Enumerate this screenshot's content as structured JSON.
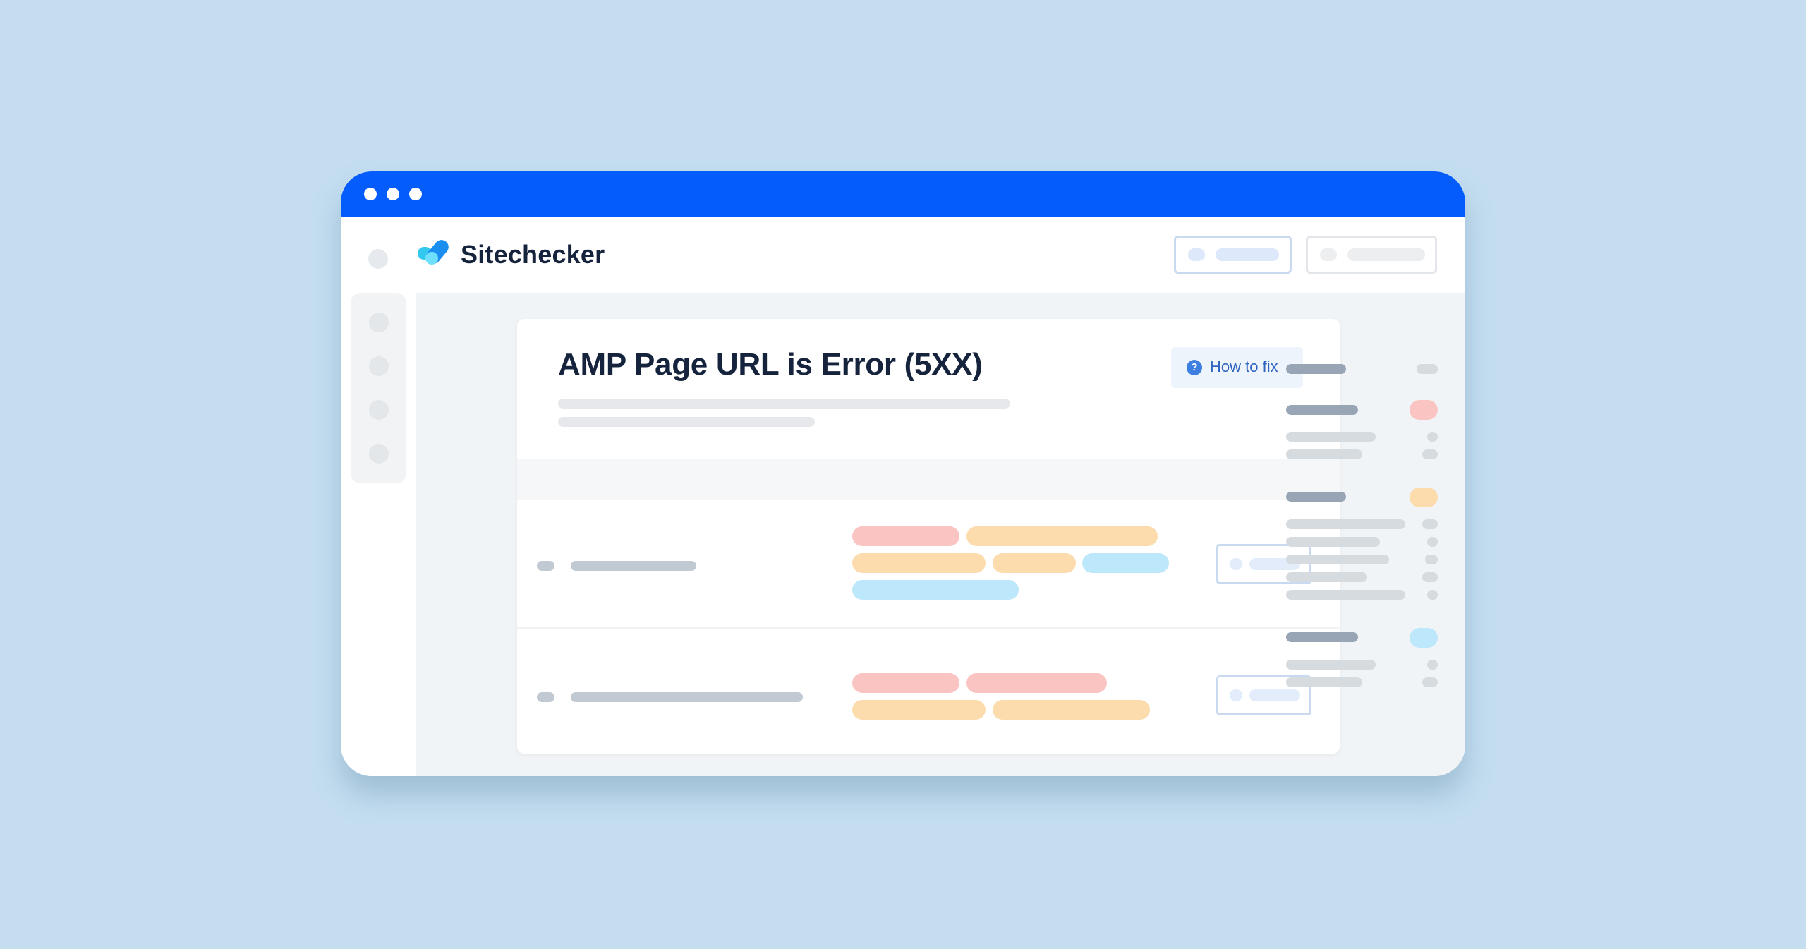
{
  "window": {
    "titlebar_color": "#045cfc",
    "controls": [
      "window-dot",
      "window-dot",
      "window-dot"
    ]
  },
  "header": {
    "brand": "Sitechecker",
    "logo_icon": "checkmark-logo-icon",
    "buttons": [
      {
        "name": "header-button-primary",
        "style": "blue-outline"
      },
      {
        "name": "header-button-secondary",
        "style": "grey-outline"
      }
    ]
  },
  "left_nav": {
    "items": [
      "nav-item",
      "nav-item",
      "nav-item",
      "nav-item"
    ]
  },
  "issue": {
    "title": "AMP Page URL is Error (5XX)",
    "how_to_fix": {
      "label": "How to fix",
      "icon": "question-circle-icon",
      "color": "#2f63c0"
    }
  },
  "table": {
    "rows": [
      {
        "tags": [
          [
            "pink",
            "orange"
          ],
          [
            "orange",
            "orange",
            "blue"
          ],
          [
            "blue"
          ]
        ]
      },
      {
        "tags": [
          [
            "pink",
            "pink"
          ],
          [
            "orange",
            "orange"
          ]
        ]
      }
    ]
  },
  "tag_colors": {
    "pink": "#f9c4c1",
    "orange": "#fcdcad",
    "blue": "#bde7fa"
  },
  "right_panel": {
    "groups": [
      {
        "badge": null,
        "sub_items": 0
      },
      {
        "badge": "pink",
        "sub_items": 2
      },
      {
        "badge": "orange",
        "sub_items": 5
      },
      {
        "badge": "blue",
        "sub_items": 2
      }
    ]
  }
}
